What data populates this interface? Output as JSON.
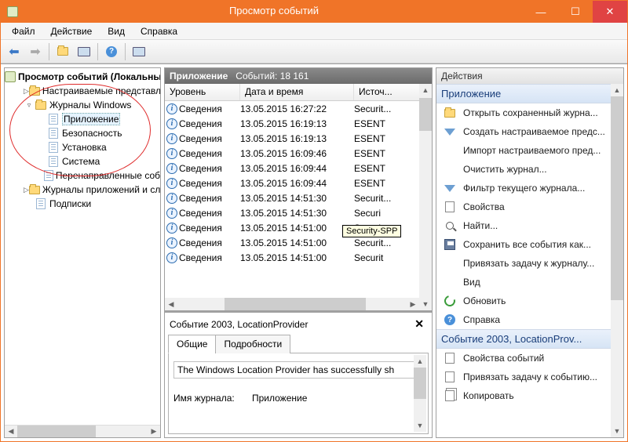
{
  "window": {
    "title": "Просмотр событий"
  },
  "menubar": {
    "file": "Файл",
    "action": "Действие",
    "view": "Вид",
    "help": "Справка"
  },
  "tree": {
    "header": "Просмотр событий (Локальны",
    "items": [
      {
        "indent": 0,
        "twist": "",
        "icon": "ev",
        "label": "Просмотр событий (Локальны",
        "header": true
      },
      {
        "indent": 1,
        "twist": "▷",
        "icon": "folder",
        "label": "Настраиваемые представл"
      },
      {
        "indent": 1,
        "twist": "▿",
        "icon": "folder",
        "label": "Журналы Windows"
      },
      {
        "indent": 2,
        "twist": "",
        "icon": "log",
        "label": "Приложение",
        "selected": true
      },
      {
        "indent": 2,
        "twist": "",
        "icon": "log",
        "label": "Безопасность"
      },
      {
        "indent": 2,
        "twist": "",
        "icon": "log",
        "label": "Установка"
      },
      {
        "indent": 2,
        "twist": "",
        "icon": "log",
        "label": "Система"
      },
      {
        "indent": 2,
        "twist": "",
        "icon": "log",
        "label": "Перенаправленные соб"
      },
      {
        "indent": 1,
        "twist": "▷",
        "icon": "folder",
        "label": "Журналы приложений и сл"
      },
      {
        "indent": 1,
        "twist": "",
        "icon": "log",
        "label": "Подписки"
      }
    ]
  },
  "center": {
    "title": "Приложение",
    "count": "Событий: 18 161",
    "columns": {
      "level": "Уровень",
      "datetime": "Дата и время",
      "source": "Источ..."
    },
    "rows": [
      {
        "level": "Сведения",
        "dt": "13.05.2015 16:27:22",
        "src": "Securit..."
      },
      {
        "level": "Сведения",
        "dt": "13.05.2015 16:19:13",
        "src": "ESENT"
      },
      {
        "level": "Сведения",
        "dt": "13.05.2015 16:19:13",
        "src": "ESENT"
      },
      {
        "level": "Сведения",
        "dt": "13.05.2015 16:09:46",
        "src": "ESENT"
      },
      {
        "level": "Сведения",
        "dt": "13.05.2015 16:09:44",
        "src": "ESENT"
      },
      {
        "level": "Сведения",
        "dt": "13.05.2015 16:09:44",
        "src": "ESENT"
      },
      {
        "level": "Сведения",
        "dt": "13.05.2015 14:51:30",
        "src": "Securit..."
      },
      {
        "level": "Сведения",
        "dt": "13.05.2015 14:51:30",
        "src": "Securi"
      },
      {
        "level": "Сведения",
        "dt": "13.05.2015 14:51:00",
        "src": "Securi"
      },
      {
        "level": "Сведения",
        "dt": "13.05.2015 14:51:00",
        "src": "Securit..."
      },
      {
        "level": "Сведения",
        "dt": "13.05.2015 14:51:00",
        "src": "Securit"
      }
    ]
  },
  "tooltip": "Security-SPP",
  "details": {
    "title": "Событие 2003, LocationProvider",
    "tab_general": "Общие",
    "tab_details": "Подробности",
    "description": "The Windows Location Provider has successfully sh",
    "meta_label": "Имя журнала:",
    "meta_value": "Приложение"
  },
  "actions": {
    "header": "Действия",
    "section1_title": "Приложение",
    "section1_items": [
      {
        "icon": "folder",
        "label": "Открыть сохраненный журна..."
      },
      {
        "icon": "funnel",
        "label": "Создать настраиваемое предс..."
      },
      {
        "icon": "",
        "label": "Импорт настраиваемого пред..."
      },
      {
        "icon": "",
        "label": "Очистить журнал..."
      },
      {
        "icon": "funnel",
        "label": "Фильтр текущего журнала..."
      },
      {
        "icon": "prop",
        "label": "Свойства"
      },
      {
        "icon": "find",
        "label": "Найти..."
      },
      {
        "icon": "save",
        "label": "Сохранить все события как..."
      },
      {
        "icon": "",
        "label": "Привязать задачу к журналу..."
      },
      {
        "icon": "",
        "label": "Вид",
        "submenu": true
      },
      {
        "icon": "refresh",
        "label": "Обновить"
      },
      {
        "icon": "help",
        "label": "Справка",
        "submenu": true
      }
    ],
    "section2_title": "Событие 2003, LocationProv...",
    "section2_items": [
      {
        "icon": "prop",
        "label": "Свойства событий"
      },
      {
        "icon": "prop",
        "label": "Привязать задачу к событию..."
      },
      {
        "icon": "copy",
        "label": "Копировать",
        "submenu": true
      }
    ]
  }
}
